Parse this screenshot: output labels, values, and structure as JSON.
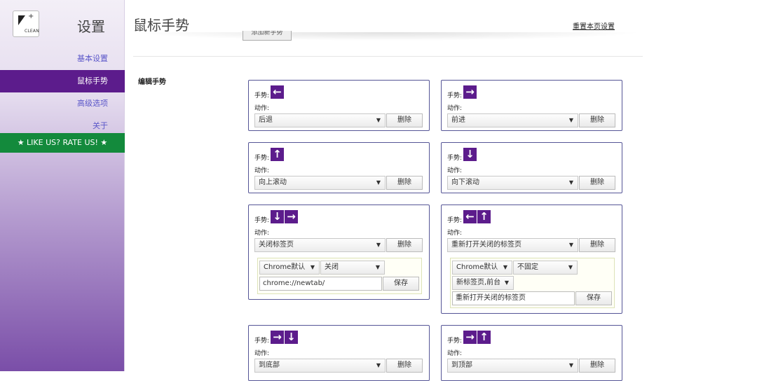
{
  "sidebar": {
    "logo_text": "CLEAN",
    "title": "设置",
    "items": [
      {
        "label": "基本设置"
      },
      {
        "label": "鼠标手势"
      },
      {
        "label": "高级选项"
      },
      {
        "label": "关于"
      }
    ],
    "rate_label": "★ LIKE US? RATE US! ★"
  },
  "header": {
    "title": "鼠标手势",
    "reset_label": "重置本页设置",
    "add_label": "添加新手势"
  },
  "section": {
    "label": "编辑手势"
  },
  "labels": {
    "gesture": "手势:",
    "action": "动作:",
    "delete": "删除",
    "save": "保存"
  },
  "gestures": [
    {
      "arrows": [
        "←"
      ],
      "action": "后退"
    },
    {
      "arrows": [
        "→"
      ],
      "action": "前进"
    },
    {
      "arrows": [
        "↑"
      ],
      "action": "向上滚动"
    },
    {
      "arrows": [
        "↓"
      ],
      "action": "向下滚动"
    },
    {
      "arrows": [
        "↓",
        "→"
      ],
      "action": "关闭标签页",
      "options": {
        "browser": "Chrome默认",
        "mode": "关闭",
        "url": "chrome://newtab/"
      }
    },
    {
      "arrows": [
        "←",
        "↑"
      ],
      "action": "重新打开关闭的标签页",
      "options": {
        "browser": "Chrome默认",
        "mode": "不固定",
        "position": "新标签页,前台",
        "text": "重新打开关闭的标签页"
      }
    },
    {
      "arrows": [
        "→",
        "↓"
      ],
      "action": "到底部"
    },
    {
      "arrows": [
        "→",
        "↑"
      ],
      "action": "到顶部"
    }
  ],
  "colors": {
    "accent": "#5c1c8c",
    "rate_green": "#138a3c",
    "card_border": "#555596"
  }
}
